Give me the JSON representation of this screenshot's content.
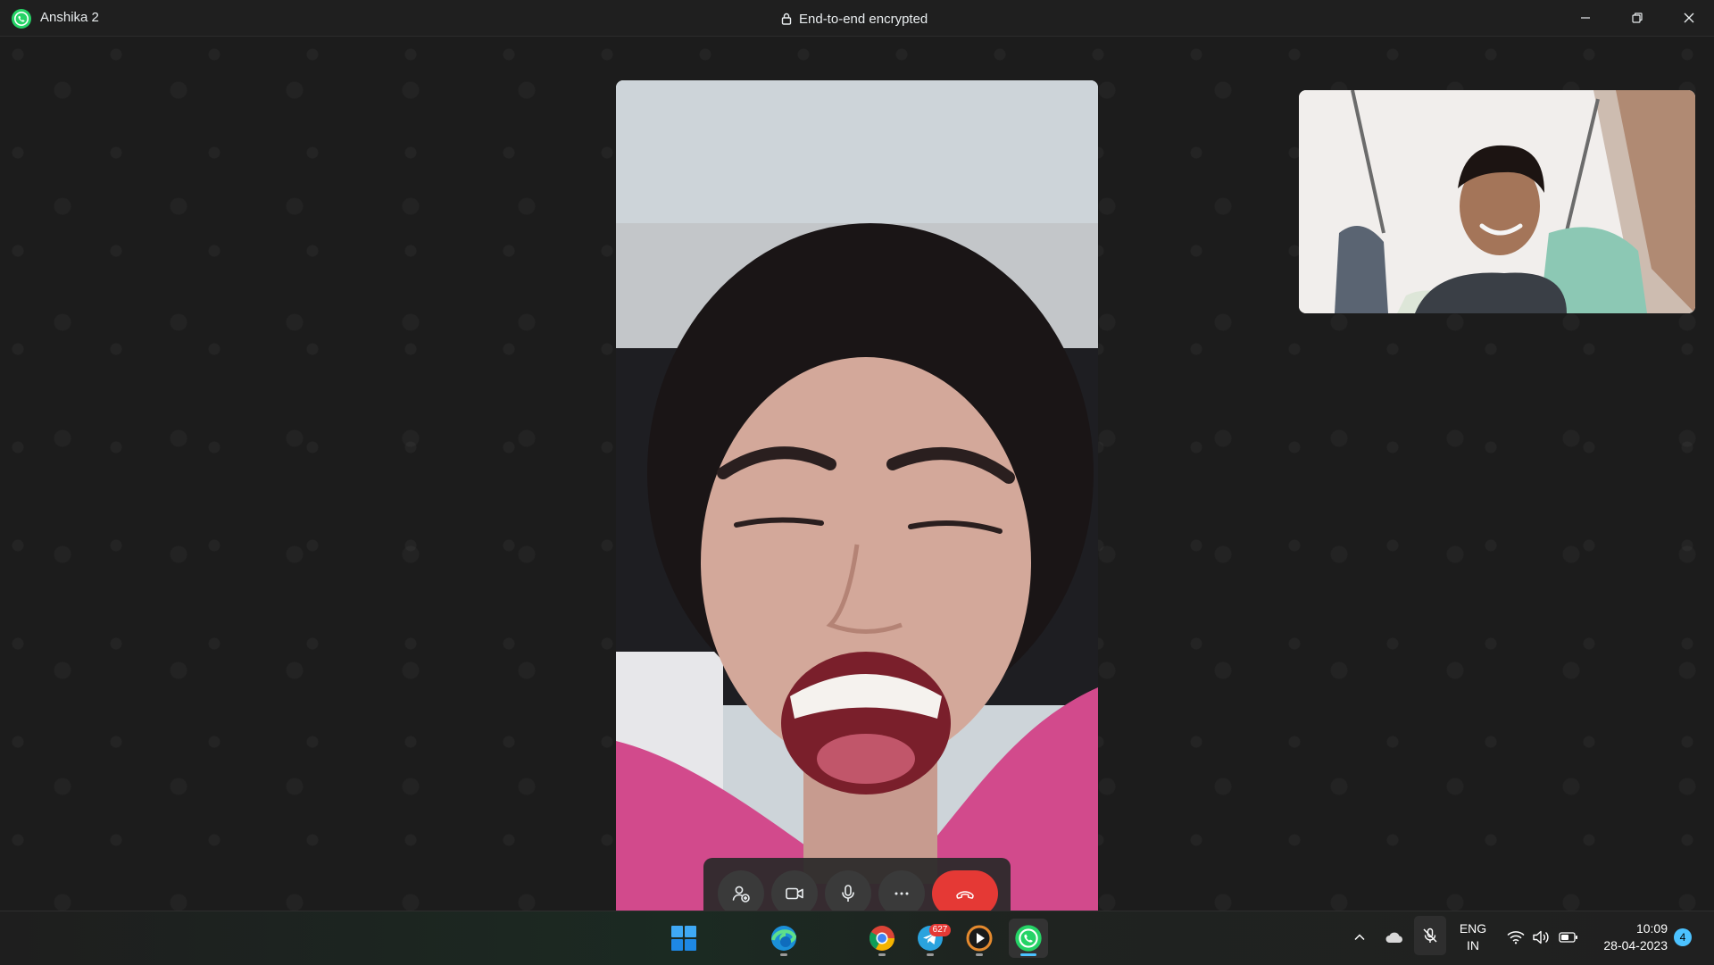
{
  "window": {
    "title": "Anshika 2",
    "encryption_label": "End-to-end encrypted",
    "controls": [
      "minimize",
      "restore",
      "close"
    ]
  },
  "call": {
    "remote_video": "remote participant video feed",
    "self_video": "self preview video feed",
    "controls": [
      {
        "name": "add-participant",
        "icon": "add-person-icon"
      },
      {
        "name": "camera",
        "icon": "video-camera-icon"
      },
      {
        "name": "microphone",
        "icon": "microphone-icon"
      },
      {
        "name": "more-options",
        "icon": "more-dots-icon"
      },
      {
        "name": "end-call",
        "icon": "end-call-icon",
        "color": "#e53935"
      }
    ]
  },
  "taskbar": {
    "apps": [
      {
        "name": "start",
        "icon": "windows-start-icon"
      },
      {
        "name": "edge",
        "icon": "edge-browser-icon"
      },
      {
        "name": "chrome",
        "icon": "chrome-icon"
      },
      {
        "name": "telegram",
        "icon": "telegram-icon",
        "badge": "627"
      },
      {
        "name": "media-player",
        "icon": "media-player-icon"
      },
      {
        "name": "whatsapp",
        "icon": "whatsapp-icon",
        "active": true
      }
    ],
    "tray": {
      "language_line1": "ENG",
      "language_line2": "IN",
      "time": "10:09",
      "date": "28-04-2023",
      "notifications": "4"
    }
  },
  "colors": {
    "accent": "#4cc2ff",
    "end_call": "#e53935",
    "whatsapp": "#25d366"
  }
}
